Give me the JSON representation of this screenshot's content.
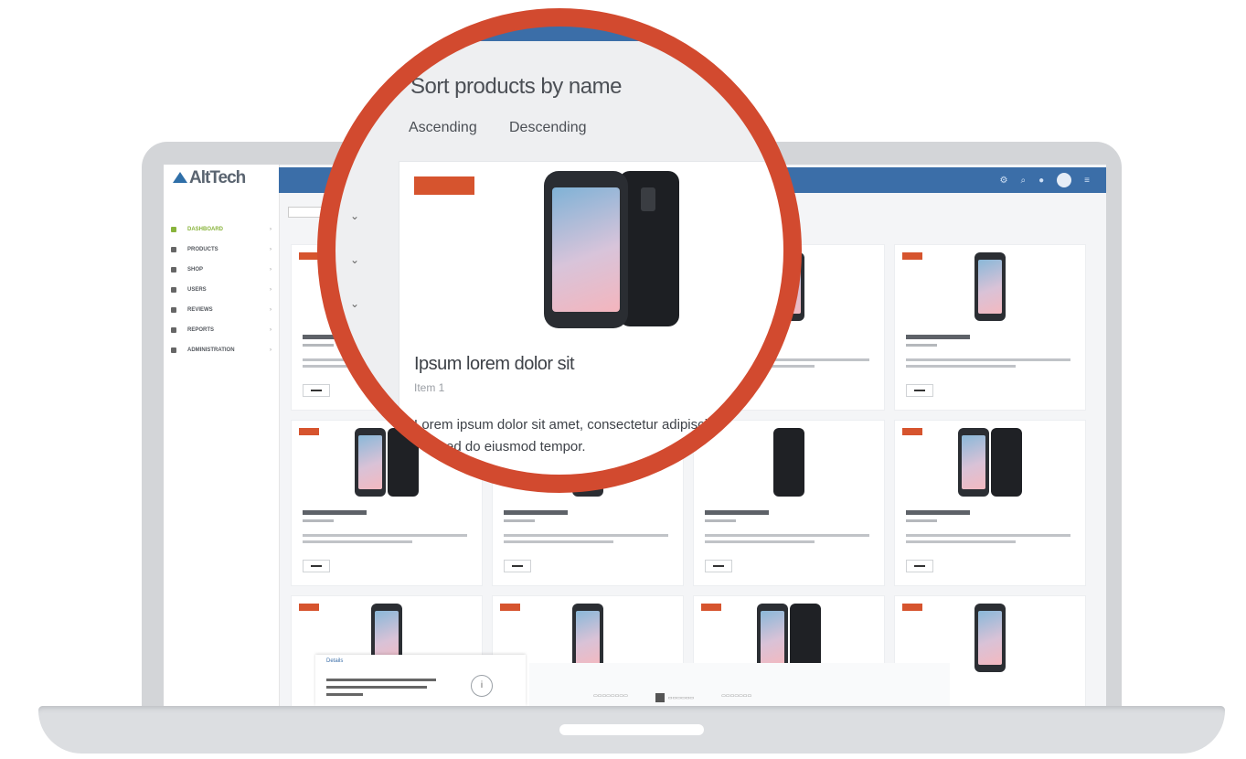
{
  "app": {
    "brand": "AltTech"
  },
  "sidebar": {
    "items": [
      {
        "label": "Dashboard",
        "active": true
      },
      {
        "label": "Products",
        "active": false
      },
      {
        "label": "Shop",
        "active": false
      },
      {
        "label": "Users",
        "active": false
      },
      {
        "label": "Reviews",
        "active": false
      },
      {
        "label": "Reports",
        "active": false
      },
      {
        "label": "Administration",
        "active": false
      }
    ]
  },
  "sort": {
    "title": "Sort products by name",
    "ascending_label": "Ascending",
    "descending_label": "Descending"
  },
  "featured_product": {
    "name": "Ipsum lorem dolor sit",
    "subtitle": "Item 1",
    "description": "Lorem ipsum dolor sit amet, consectetur adipiscing elit, sed do eiusmod tempor."
  },
  "bottom_panel": {
    "title": "Details"
  },
  "colors": {
    "accent": "#3b6ea8",
    "badge": "#d6542e",
    "ring": "#d24a2f",
    "active_nav": "#89b43c"
  }
}
